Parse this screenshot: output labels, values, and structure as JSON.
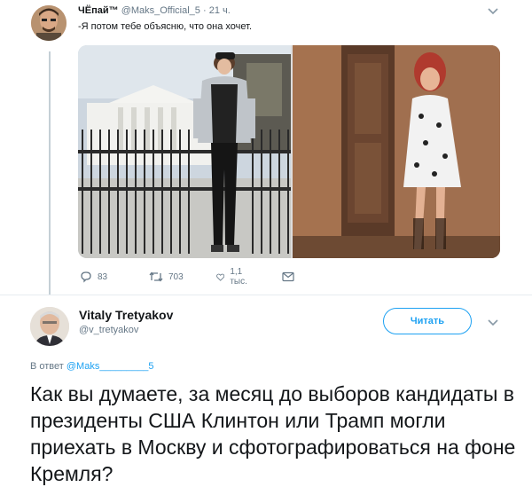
{
  "tweet1": {
    "display_name": "ЧЁпай™",
    "handle": "@Maks_Official_5",
    "separator": "·",
    "time": "21 ч.",
    "text": "-Я потом тебе объясню, что она хочет.",
    "images": [
      "white-house-photo",
      "kremlin-door-photo"
    ],
    "actions": {
      "reply_count": "83",
      "retweet_count": "703",
      "like_count": "1,1 тыс."
    }
  },
  "tweet2": {
    "display_name": "Vitaly Tretyakov",
    "handle": "@v_tretyakov",
    "follow_label": "Читать",
    "reply_prefix": "В ответ",
    "reply_to": "@Maks_________5",
    "text": "Как вы думаете, за месяц до выборов кандидаты в президенты США Клинтон или Трамп могли приехать в Москву и сфотографироваться на фоне Кремля?"
  },
  "colors": {
    "accent": "#1da1f2",
    "muted": "#657786",
    "text": "#14171a",
    "divider": "#e6ecf0"
  }
}
